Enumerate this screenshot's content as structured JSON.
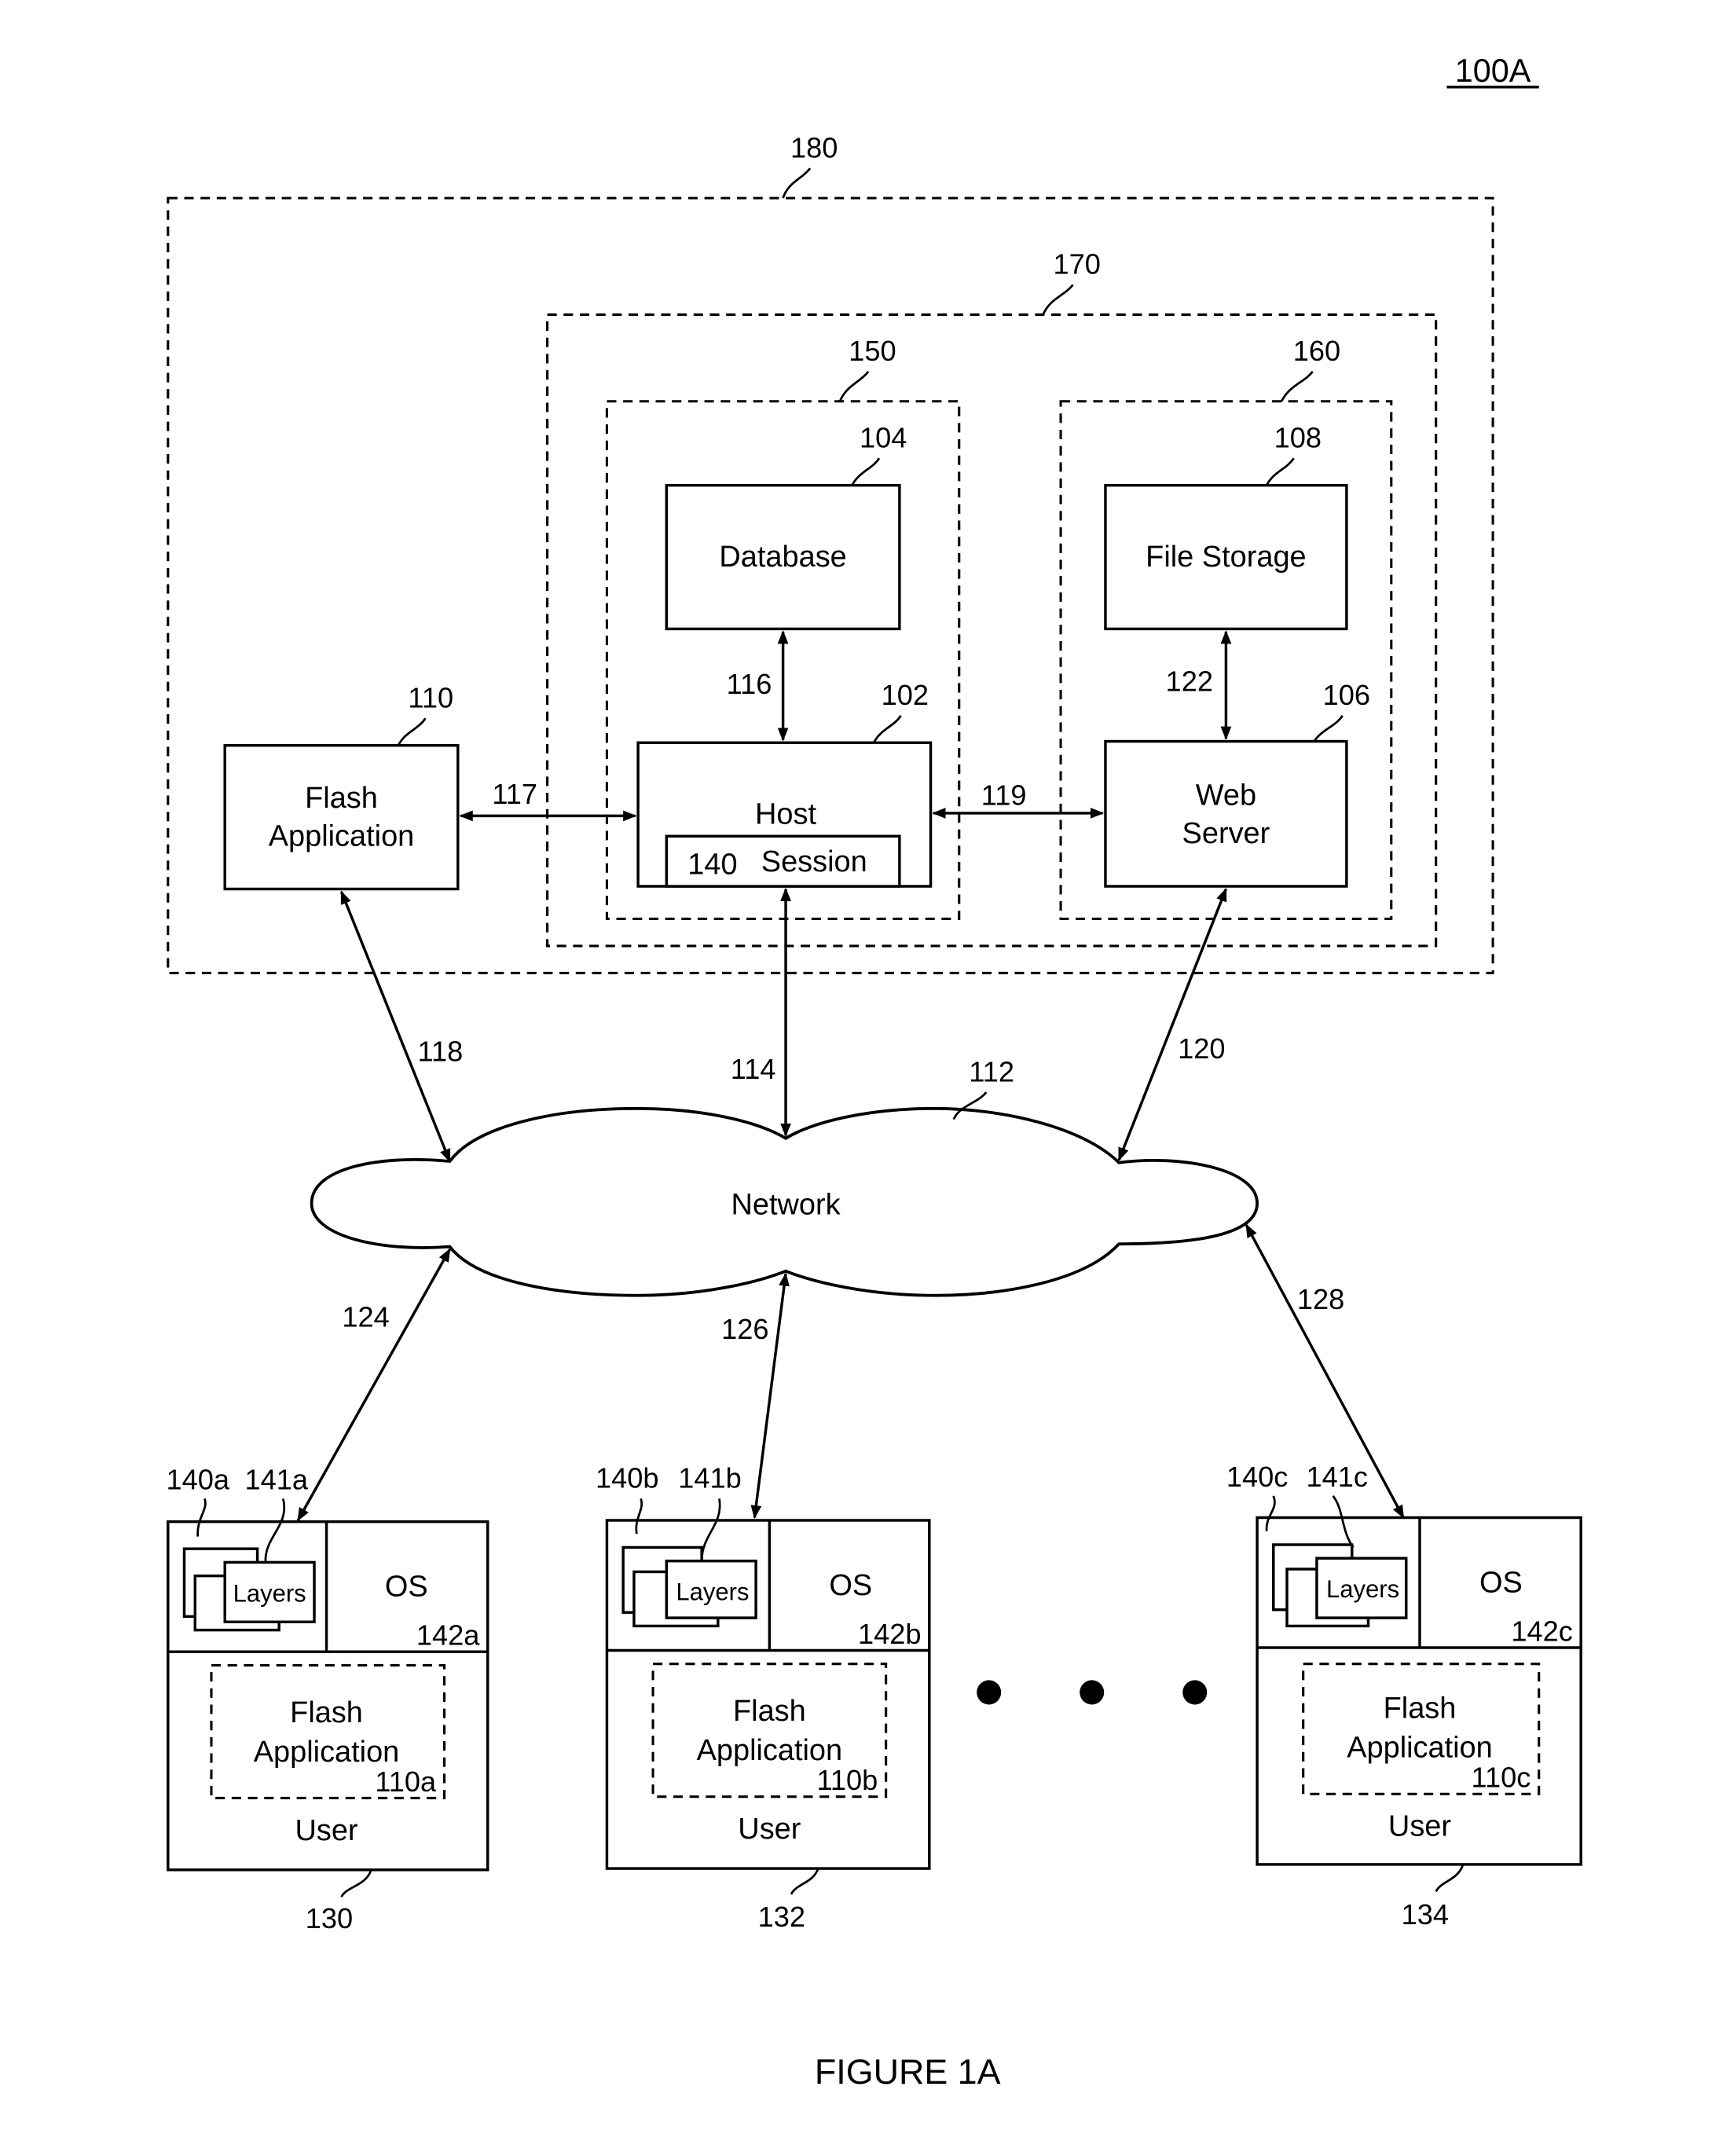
{
  "figure": {
    "id_label": "100A",
    "caption": "FIGURE 1A"
  },
  "containers": {
    "outer": {
      "ref": "180"
    },
    "server_group": {
      "ref": "170"
    },
    "db_group": {
      "ref": "150"
    },
    "file_group": {
      "ref": "160"
    }
  },
  "components": {
    "database": {
      "label": "Database",
      "ref": "104"
    },
    "file_storage": {
      "label": "File Storage",
      "ref": "108"
    },
    "host": {
      "label": "Host",
      "ref": "102"
    },
    "session": {
      "label": "Session",
      "ref": "140"
    },
    "web_server": {
      "label_line1": "Web",
      "label_line2": "Server",
      "ref": "106"
    },
    "flash_app": {
      "label_line1": "Flash",
      "label_line2": "Application",
      "ref": "110"
    },
    "network": {
      "label": "Network",
      "ref": "112"
    }
  },
  "connections": {
    "db_host": "116",
    "storage_web": "122",
    "flash_host": "117",
    "host_web": "119",
    "flash_network": "118",
    "host_network": "114",
    "web_network": "120",
    "network_user_a": "124",
    "network_user_b": "126",
    "network_user_c": "128"
  },
  "clients": [
    {
      "session_ref": "140a",
      "layers_ref": "141a",
      "layers_label": "Layers",
      "os_label": "OS",
      "os_ref": "142a",
      "app_line1": "Flash",
      "app_line2": "Application",
      "app_ref": "110a",
      "user_label": "User",
      "ref": "130"
    },
    {
      "session_ref": "140b",
      "layers_ref": "141b",
      "layers_label": "Layers",
      "os_label": "OS",
      "os_ref": "142b",
      "app_line1": "Flash",
      "app_line2": "Application",
      "app_ref": "110b",
      "user_label": "User",
      "ref": "132"
    },
    {
      "session_ref": "140c",
      "layers_ref": "141c",
      "layers_label": "Layers",
      "os_label": "OS",
      "os_ref": "142c",
      "app_line1": "Flash",
      "app_line2": "Application",
      "app_ref": "110c",
      "user_label": "User",
      "ref": "134"
    }
  ],
  "ellipsis": "more users"
}
